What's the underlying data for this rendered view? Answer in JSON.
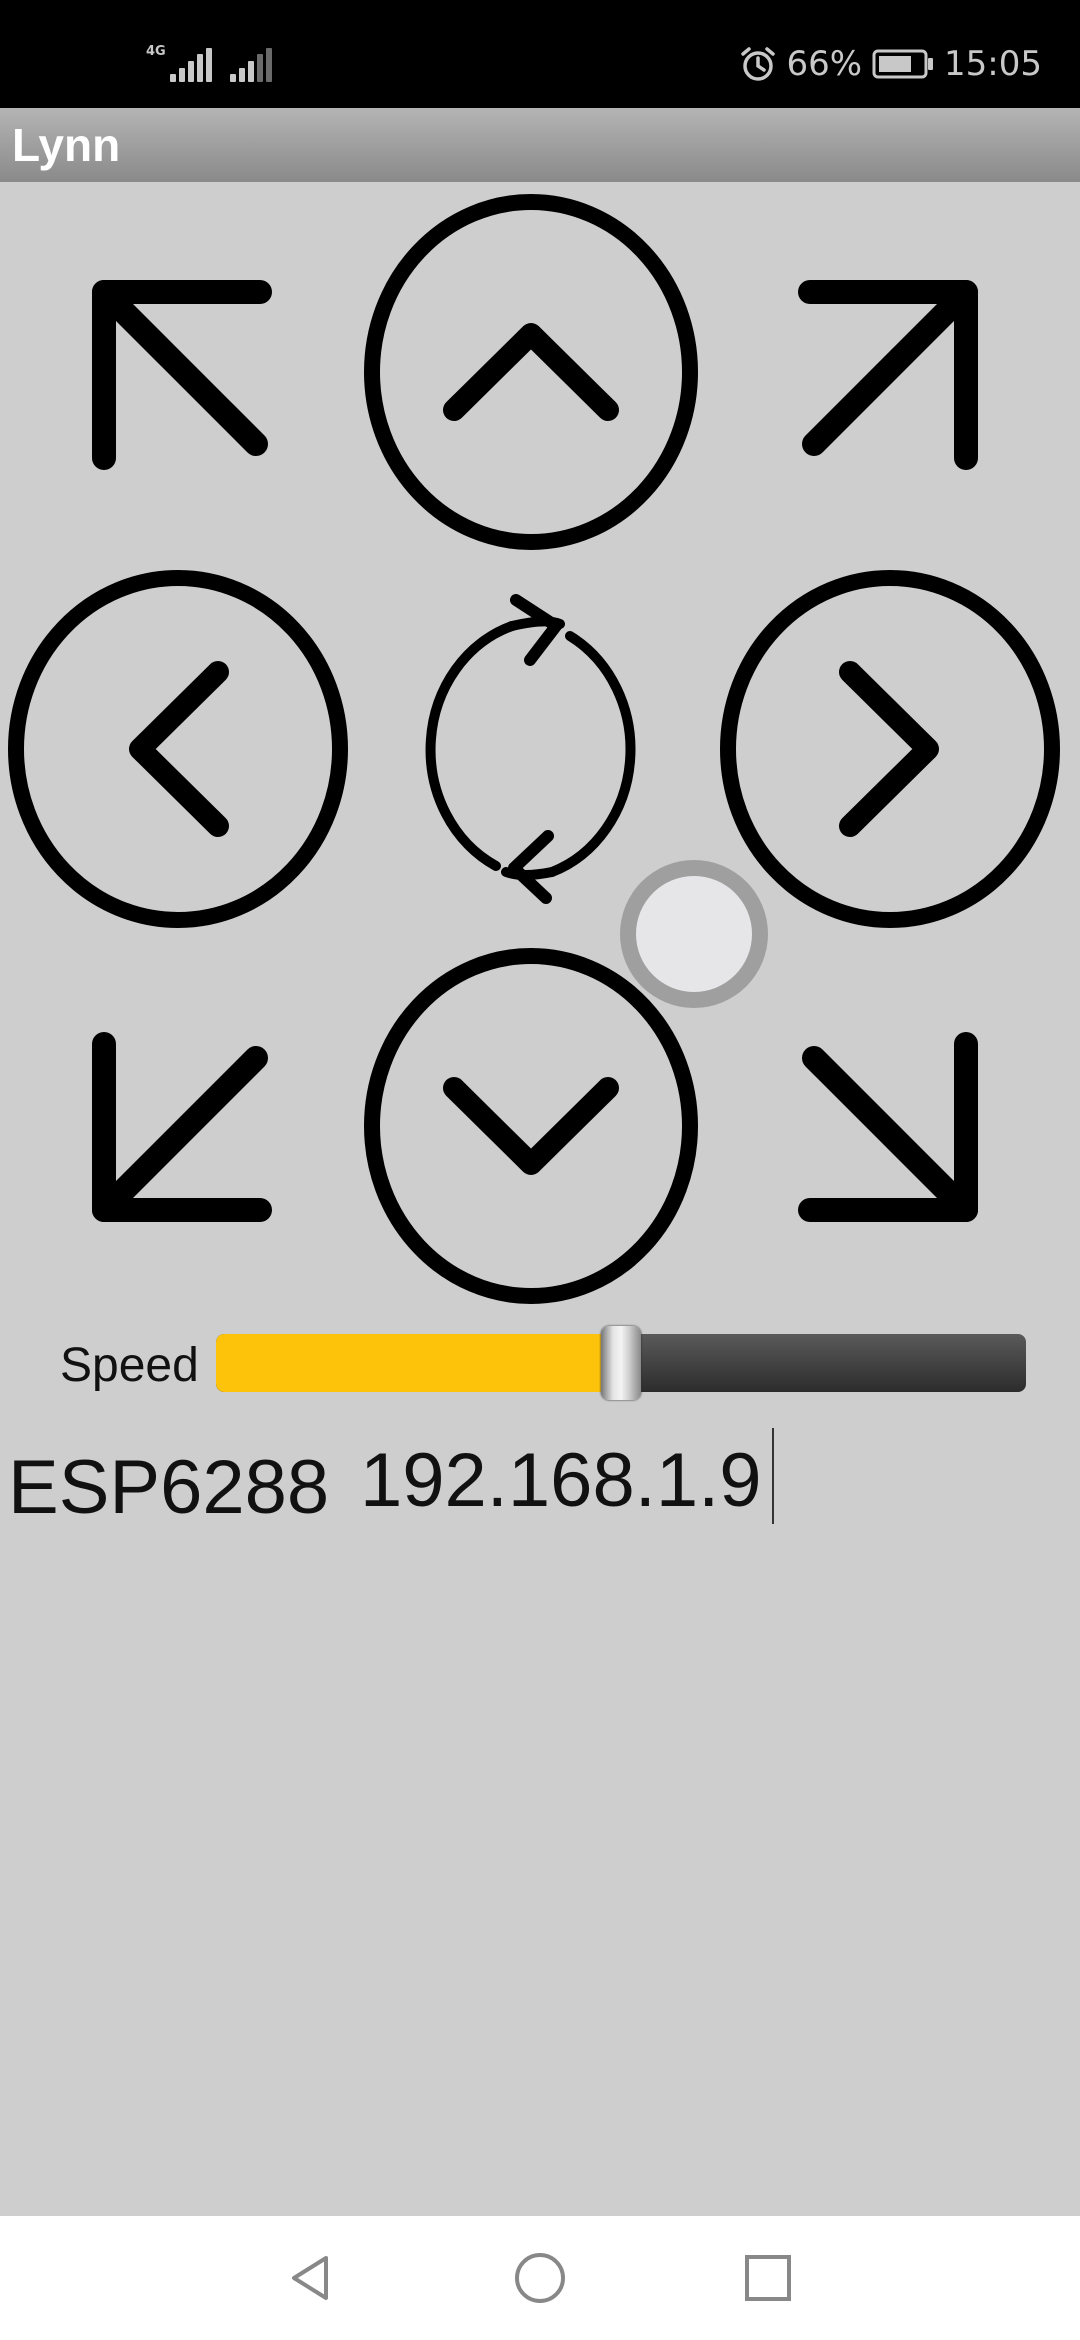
{
  "status_bar": {
    "network_type": "4G",
    "battery_percent": "66%",
    "time": "15:05",
    "icons": [
      "signal-icon",
      "signal-icon",
      "alarm-icon",
      "battery-icon"
    ]
  },
  "app": {
    "title": "Lynn"
  },
  "controls": {
    "buttons": [
      "up-left-arrow",
      "up-button",
      "up-right-arrow",
      "left-button",
      "rotate-button",
      "right-button",
      "down-left-arrow",
      "down-button",
      "down-right-arrow"
    ]
  },
  "speed": {
    "label": "Speed",
    "value": 0.5,
    "fill_color": "#fcc30a"
  },
  "device": {
    "name": "ESP6288",
    "ip": "192.168.1.9"
  },
  "nav_bar": {
    "icons": [
      "back-icon",
      "home-icon",
      "recents-icon"
    ]
  }
}
